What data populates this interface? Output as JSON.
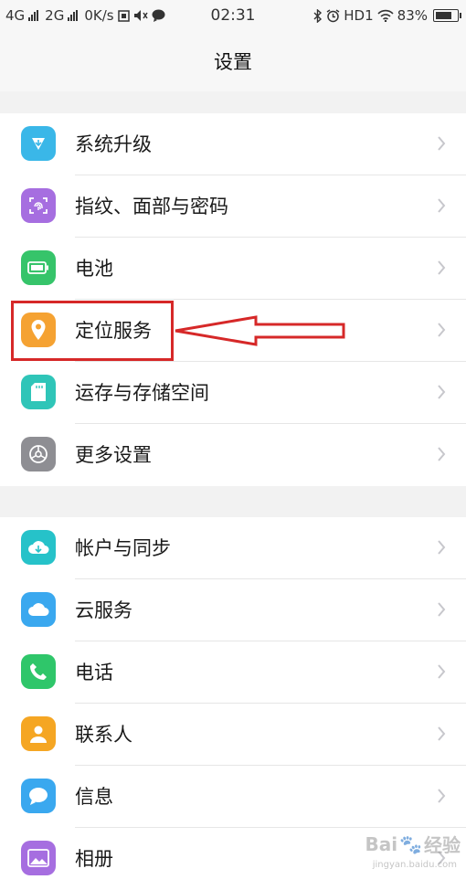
{
  "status_bar": {
    "network1": "4G",
    "network2": "2G",
    "speed": "0K/s",
    "time": "02:31",
    "hd": "HD1",
    "battery_percent": "83%",
    "battery_level": 0.83
  },
  "header": {
    "title": "设置"
  },
  "group1": {
    "items": [
      {
        "label": "系统升级",
        "icon": "system-update-icon",
        "color": "#3ab7e8"
      },
      {
        "label": "指纹、面部与密码",
        "icon": "fingerprint-icon",
        "color": "#a66ee0"
      },
      {
        "label": "电池",
        "icon": "battery-icon",
        "color": "#36c46a"
      },
      {
        "label": "定位服务",
        "icon": "location-pin-icon",
        "color": "#f5a232"
      },
      {
        "label": "运存与存储空间",
        "icon": "storage-icon",
        "color": "#2fc5b8"
      },
      {
        "label": "更多设置",
        "icon": "gear-icon",
        "color": "#8e8e93"
      }
    ]
  },
  "group2": {
    "items": [
      {
        "label": "帐户与同步",
        "icon": "cloud-sync-icon",
        "color": "#26c2c9"
      },
      {
        "label": "云服务",
        "icon": "cloud-icon",
        "color": "#3aa8ef"
      },
      {
        "label": "电话",
        "icon": "phone-icon",
        "color": "#2fc66a"
      },
      {
        "label": "联系人",
        "icon": "contacts-icon",
        "color": "#f5a623"
      },
      {
        "label": "信息",
        "icon": "message-icon",
        "color": "#3aa8ef"
      },
      {
        "label": "相册",
        "icon": "album-icon",
        "color": "#a66ee0"
      }
    ]
  },
  "watermark": {
    "brand": "Bai",
    "brand2": "经验",
    "url": "jingyan.baidu.com"
  }
}
